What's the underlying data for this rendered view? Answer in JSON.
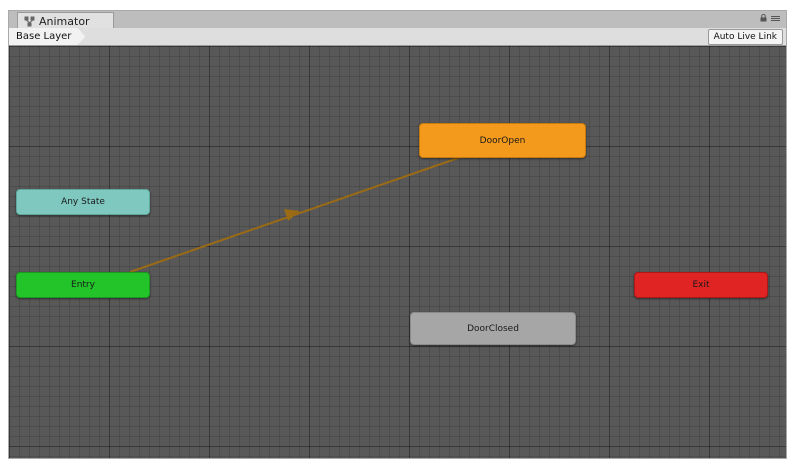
{
  "window": {
    "tab_title": "Animator",
    "tab_icon": "animator-icon",
    "controls": [
      "lock-icon",
      "menu-icon"
    ]
  },
  "toolbar": {
    "breadcrumb": "Base Layer",
    "auto_live_link": "Auto Live Link"
  },
  "graph": {
    "states": {
      "any_state": "Any State",
      "entry": "Entry",
      "door_open": "DoorOpen",
      "door_closed": "DoorClosed",
      "exit": "Exit"
    },
    "transitions": [
      {
        "from": "Entry",
        "to": "DoorOpen",
        "type": "default"
      }
    ]
  },
  "colors": {
    "any_state": "#7fc8bf",
    "entry": "#22c42a",
    "default_state": "#f39a1c",
    "state": "#a6a6a6",
    "exit": "#e02323",
    "default_transition": "#9a6a14",
    "graph_background": "#585858"
  }
}
